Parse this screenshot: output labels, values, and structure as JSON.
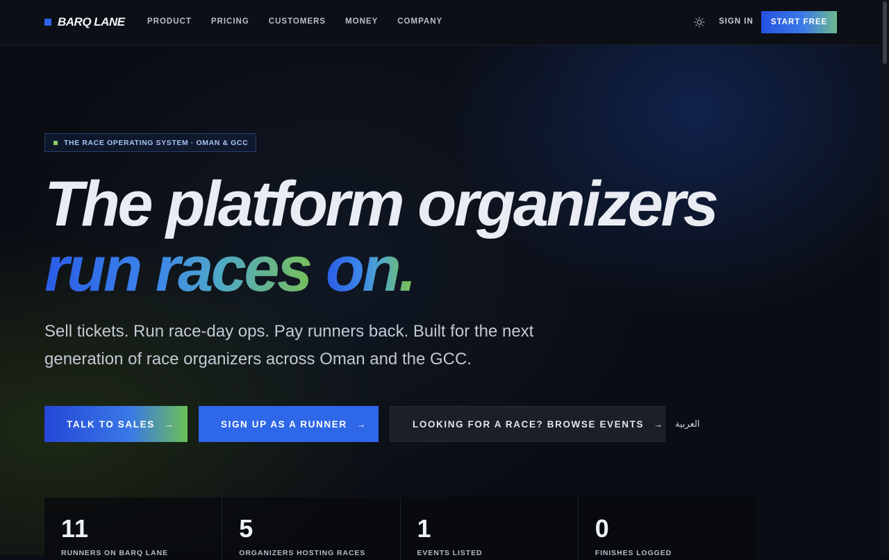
{
  "header": {
    "brand": "BARQ LANE",
    "nav": [
      "PRODUCT",
      "PRICING",
      "CUSTOMERS",
      "MONEY",
      "COMPANY"
    ],
    "theme_icon": "sun-icon",
    "sign_in": "SIGN IN",
    "start_free": "START FREE"
  },
  "hero": {
    "eyebrow": "THE RACE OPERATING SYSTEM · OMAN & GCC",
    "headline_line1": "The platform organizers",
    "headline_line2_a": "run races ",
    "headline_line2_b": "on.",
    "subtitle": "Sell tickets. Run race-day ops. Pay runners back. Built for the next generation of race organizers across Oman and the GCC."
  },
  "ctas": {
    "talk_to_sales": "TALK TO SALES",
    "sign_up_runner": "SIGN UP AS A RUNNER",
    "browse_events": "LOOKING FOR A RACE? BROWSE EVENTS",
    "arrow_icon": "arrow-right-icon",
    "language": "العربية"
  },
  "stats": [
    {
      "value": "11",
      "label": "RUNNERS ON BARQ LANE"
    },
    {
      "value": "5",
      "label": "ORGANIZERS HOSTING RACES"
    },
    {
      "value": "1",
      "label": "EVENTS LISTED"
    },
    {
      "value": "0",
      "label": "FINISHES LOGGED"
    }
  ],
  "colors": {
    "accent_blue": "#2e67e8",
    "accent_green": "#7fc24a",
    "background": "#0a0d14"
  }
}
